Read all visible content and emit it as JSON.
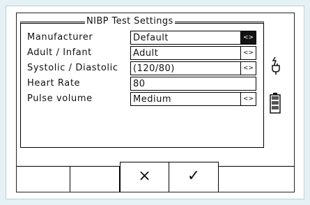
{
  "panel": {
    "title": "NIBP Test Settings",
    "rows": [
      {
        "label": "Manufacturer",
        "value": "Default",
        "selector": "<>",
        "selected": true
      },
      {
        "label": "Adult / Infant",
        "value": "Adult",
        "selector": "<>",
        "selected": false
      },
      {
        "label": "Systolic / Diastolic",
        "value": "(120/80)",
        "selector": "<>",
        "selected": false
      },
      {
        "label": "Heart Rate",
        "value": "80"
      },
      {
        "label": "Pulse volume",
        "value": "Medium",
        "selector": "<>",
        "selected": false
      }
    ]
  },
  "softkeys": {
    "cancel_glyph": "×",
    "confirm_glyph": "✓"
  },
  "side_icons": [
    "plug-icon",
    "battery-icon"
  ],
  "colors": {
    "background": "#e6f1f5",
    "frame_border": "#b9cfd8",
    "ink": "#111111"
  }
}
